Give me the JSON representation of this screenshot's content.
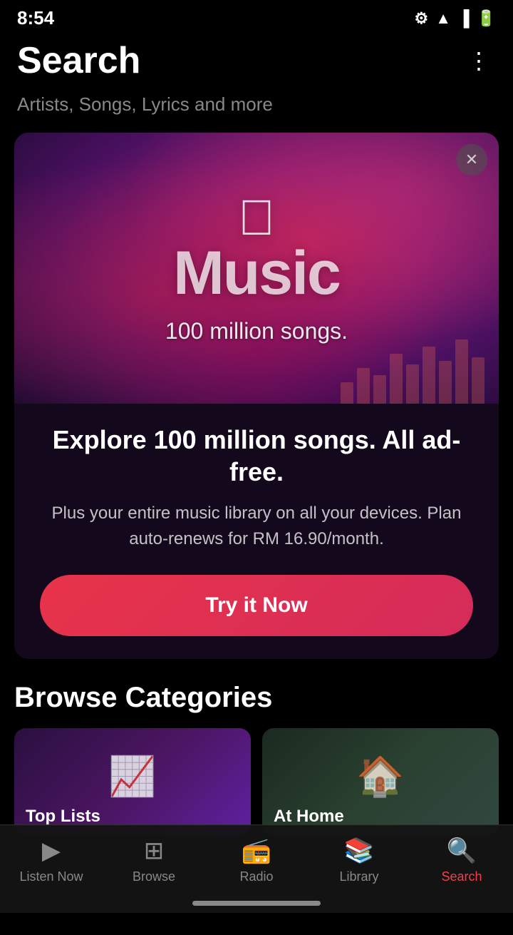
{
  "statusBar": {
    "time": "8:54",
    "settingsIcon": "⚙",
    "wifiIcon": "wifi",
    "signalIcon": "signal",
    "batteryIcon": "battery"
  },
  "header": {
    "title": "Search",
    "menuIcon": "⋮"
  },
  "searchSubtitle": "Artists, Songs, Lyrics and more",
  "promoCard": {
    "closeIcon": "✕",
    "brandTop": "",
    "brandMusic": "Music",
    "tagline": "100 million songs.",
    "headline": "Explore 100 million songs. All ad-free.",
    "description": "Plus your entire music library on all your devices. Plan auto-renews for RM 16.90/month.",
    "ctaButton": "Try it Now"
  },
  "browseSection": {
    "title": "Browse Categories",
    "categories": [
      {
        "label": "Top Lists",
        "icon": "📈",
        "colorClass": "category-card-top-lists"
      },
      {
        "label": "At Home",
        "icon": "🏠",
        "colorClass": "category-card-at-home"
      }
    ]
  },
  "bottomNav": {
    "items": [
      {
        "label": "Listen Now",
        "icon": "▶",
        "active": false
      },
      {
        "label": "Browse",
        "icon": "⊞",
        "active": false
      },
      {
        "label": "Radio",
        "icon": "📻",
        "active": false
      },
      {
        "label": "Library",
        "icon": "📚",
        "active": false
      },
      {
        "label": "Search",
        "icon": "🔍",
        "active": true
      }
    ]
  }
}
